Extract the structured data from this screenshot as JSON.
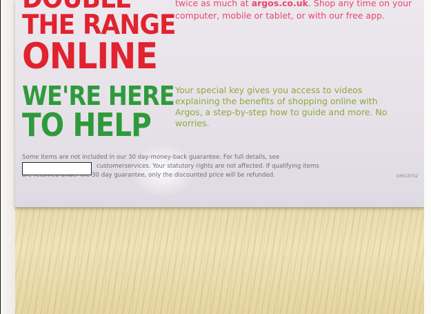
{
  "photo": {
    "subject": "Argos leaflet on a wooden table"
  },
  "leaflet": {
    "headline_red": [
      "DOUBLE",
      "THE RANGE",
      "ONLINE"
    ],
    "copy_red_prefix": "twice as much at ",
    "copy_red_link": "argos.co.uk",
    "copy_red_suffix": ". Shop any time on your computer, mobile or tablet, or with our free app.",
    "headline_green": [
      "WE'RE HERE",
      "TO HELP"
    ],
    "copy_green": "Your special key gives you access to videos explaining the benefits of shopping online with Argos, a step-by-step how to guide and more. No worries.",
    "fine_print": [
      "Some items are not included in our 30 day-money-back guarantee. For full details, see",
      "customerservices. Your statutory rights are not affected. If qualifying items",
      "are returned under the 30 day guarantee, only the discounted price will be refunded."
    ],
    "code": "DMCAT02"
  },
  "colors": {
    "brand_red": "#e0232f",
    "brand_green": "#2f9a3c",
    "table": "#e9dcae"
  }
}
